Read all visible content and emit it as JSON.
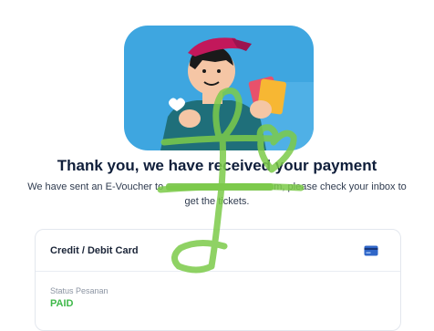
{
  "confirmation": {
    "title": "Thank you, we have received your payment",
    "subtitle_before": "We have sent an E-Voucher to",
    "subtitle_after": "m, please check your inbox to get the tickets."
  },
  "payment_card": {
    "method_label": "Credit / Debit Card",
    "method_icon": "credit-card-icon",
    "status_label": "Status Pesanan",
    "status_value": "PAID"
  },
  "colors": {
    "hero_background": "#3ea6e0",
    "status_paid": "#3fb94a",
    "card_icon": "#2f66c8",
    "scribble": "#6fbf3b"
  }
}
